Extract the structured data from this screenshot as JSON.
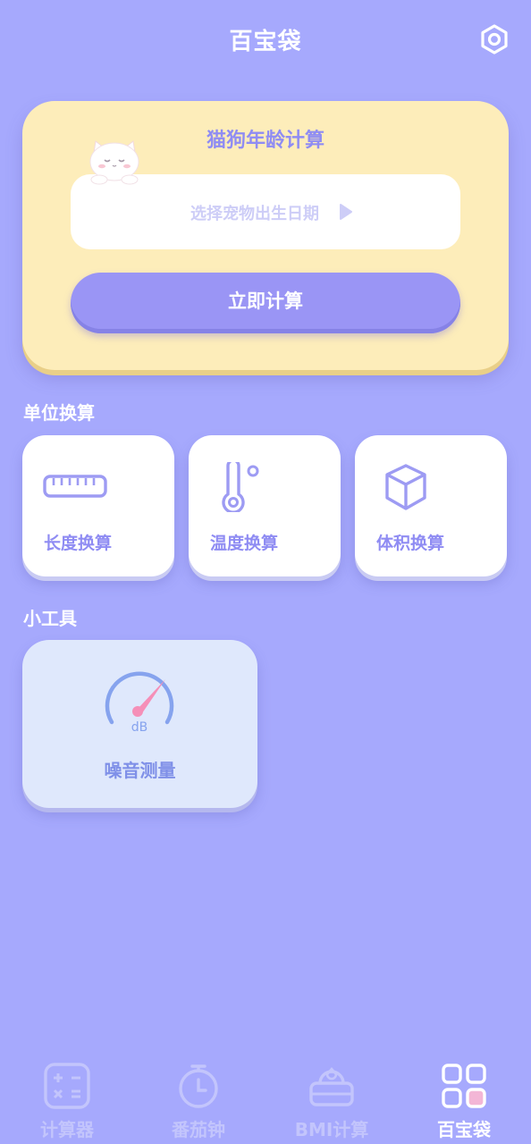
{
  "header": {
    "title": "百宝袋",
    "settings_icon": "settings-ring-icon"
  },
  "pet_age": {
    "title": "猫狗年龄计算",
    "date_placeholder": "选择宠物出生日期",
    "calc_button": "立即计算"
  },
  "unit_section": {
    "title": "单位换算",
    "items": [
      {
        "label": "长度换算",
        "icon": "ruler-icon"
      },
      {
        "label": "温度换算",
        "icon": "thermometer-icon"
      },
      {
        "label": "体积换算",
        "icon": "cube-icon"
      }
    ]
  },
  "tools_section": {
    "title": "小工具",
    "items": [
      {
        "label": "噪音测量",
        "icon": "decibel-gauge-icon",
        "icon_text": "dB"
      }
    ]
  },
  "bottom_nav": {
    "items": [
      {
        "label": "计算器",
        "icon": "calculator-icon",
        "active": false
      },
      {
        "label": "番茄钟",
        "icon": "timer-icon",
        "active": false
      },
      {
        "label": "BMI计算",
        "icon": "scale-icon",
        "active": false
      },
      {
        "label": "百宝袋",
        "icon": "grid-icon",
        "active": true
      }
    ]
  },
  "colors": {
    "background": "#a6a9fd",
    "accent_purple": "#9a95f5",
    "pet_card": "#fdedba",
    "tool_card": "#dfe8fc",
    "inactive_nav": "#c3c5fc",
    "gauge_pink": "#f58fb8"
  }
}
